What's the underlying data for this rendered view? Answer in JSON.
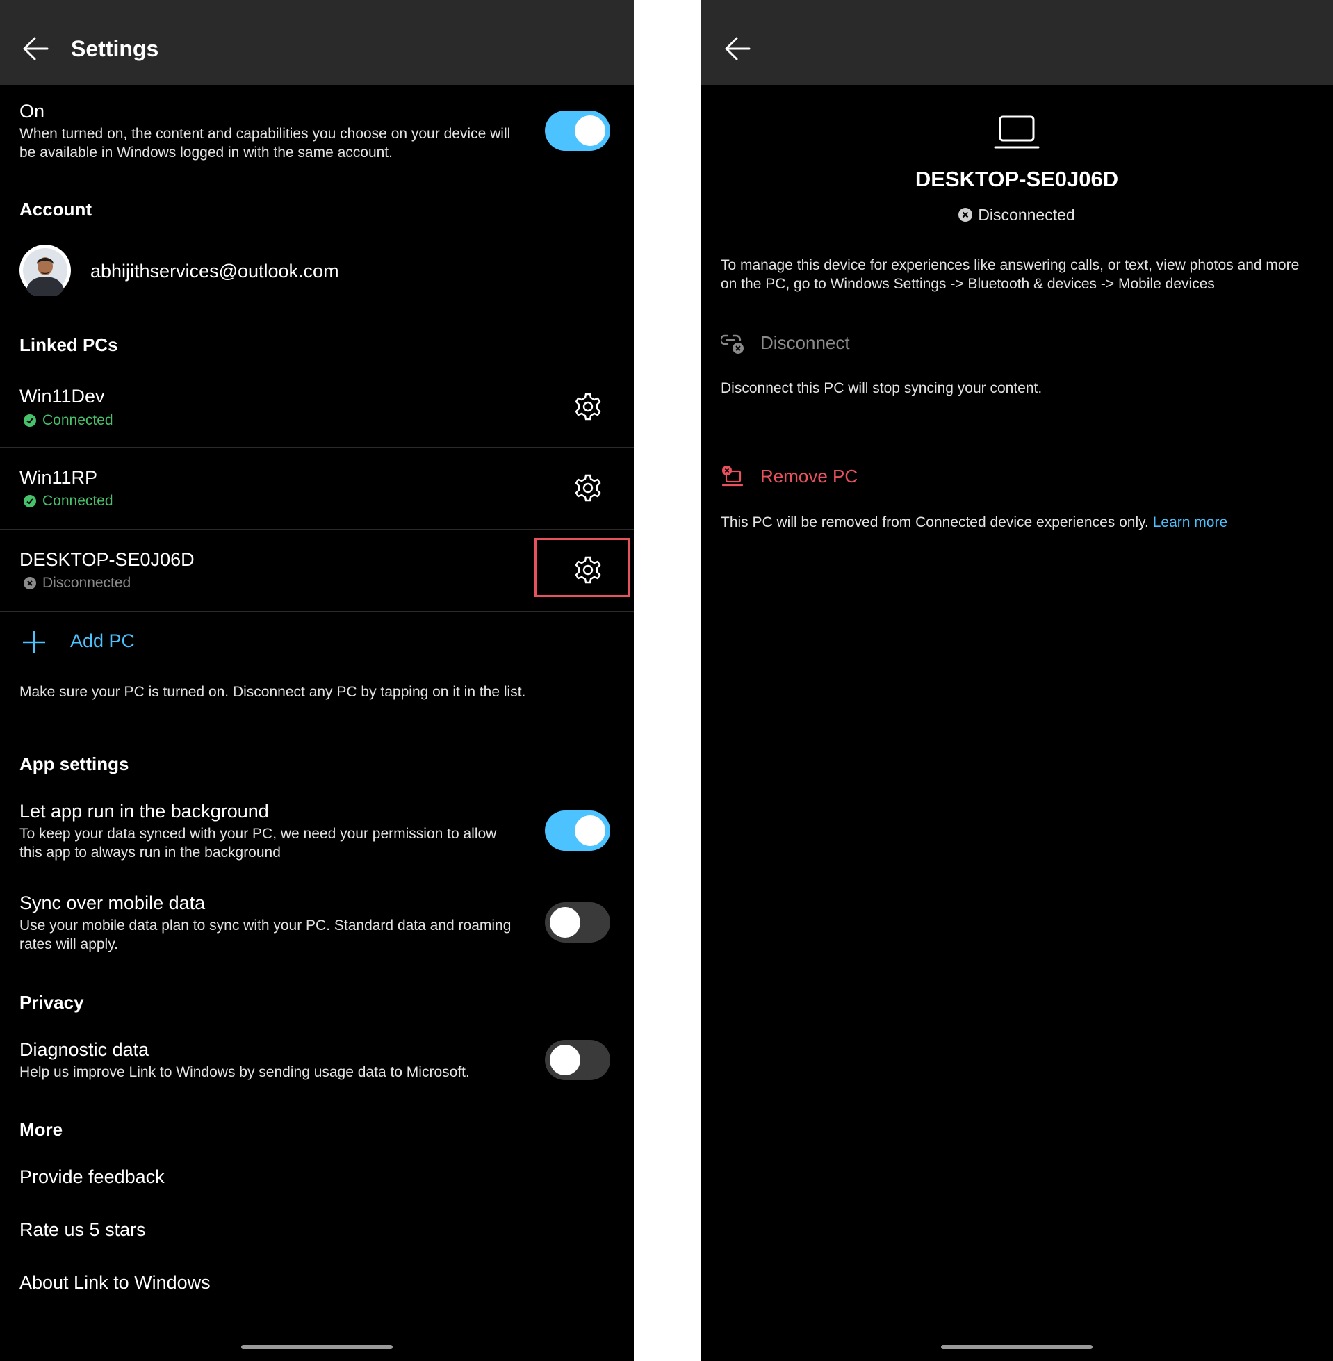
{
  "left": {
    "header": {
      "title": "Settings"
    },
    "master_toggle": {
      "label": "On",
      "description_line1": "When turned on, the content and capabilities you choose on your device will",
      "description_line2": "be available in Windows logged in with the same account.",
      "state": "on"
    },
    "account": {
      "heading": "Account",
      "email": "abhijithservices@outlook.com"
    },
    "linked_pcs": {
      "heading": "Linked PCs",
      "items": [
        {
          "name": "Win11Dev",
          "status": "Connected",
          "state": "connected"
        },
        {
          "name": "Win11RP",
          "status": "Connected",
          "state": "connected"
        },
        {
          "name": "DESKTOP-SE0J06D",
          "status": "Disconnected",
          "state": "disconnected"
        }
      ],
      "add_label": "Add PC",
      "hint": "Make sure your PC is turned on. Disconnect any PC by tapping on it in the list."
    },
    "app_settings": {
      "heading": "App settings",
      "background": {
        "label": "Let app run in the background",
        "line1": "To keep your data synced with your PC, we need your permission to allow",
        "line2": "this app to always run in the background",
        "state": "on"
      },
      "mobile_data": {
        "label": "Sync over mobile data",
        "line1": "Use your mobile data plan to sync with your PC. Standard data and roaming",
        "line2": "rates will apply.",
        "state": "off"
      }
    },
    "privacy": {
      "heading": "Privacy",
      "diagnostic": {
        "label": "Diagnostic data",
        "line1": "Help us improve Link to Windows by sending usage data to Microsoft.",
        "state": "off"
      }
    },
    "more": {
      "heading": "More",
      "items": [
        "Provide feedback",
        "Rate us 5 stars",
        "About Link to Windows"
      ]
    }
  },
  "right": {
    "device_name": "DESKTOP-SE0J06D",
    "status": "Disconnected",
    "info_line1": "To manage this device for experiences like answering calls, or text, view photos and more",
    "info_line2": "on the PC, go to Windows Settings -> Bluetooth & devices -> Mobile devices",
    "disconnect_label": "Disconnect",
    "disconnect_desc": "Disconnect this PC will stop syncing your content.",
    "remove_label": "Remove PC",
    "remove_desc": "This PC will be removed from Connected device experiences only.",
    "learn_more": "Learn more"
  },
  "colors": {
    "accent": "#4cc2ff",
    "connected": "#47c26b",
    "danger": "#e8525f",
    "muted": "#8a8a8a",
    "header_bg": "#2a2a2a"
  }
}
